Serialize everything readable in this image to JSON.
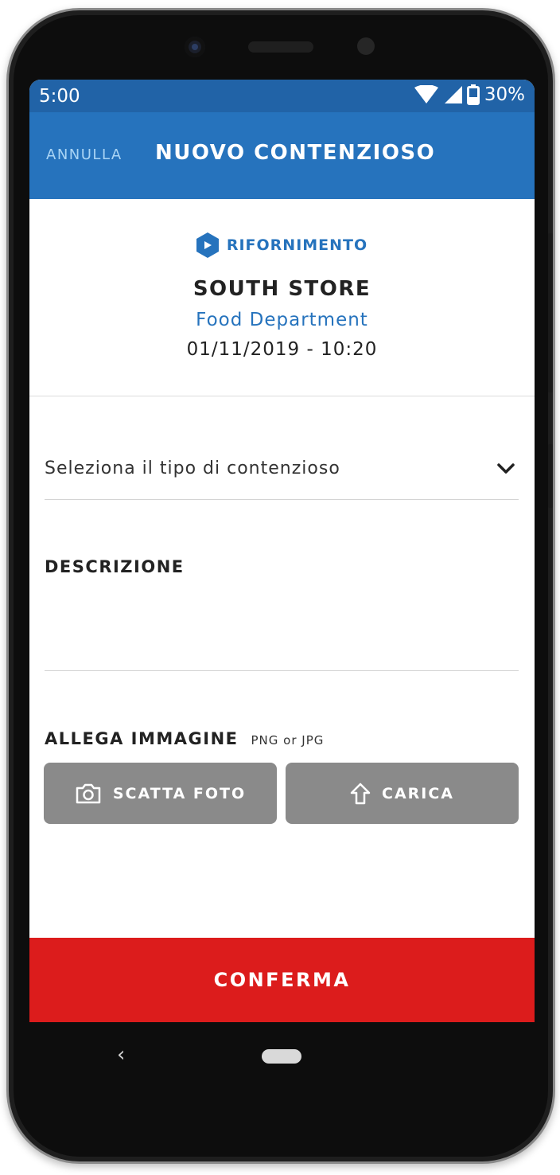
{
  "status_bar": {
    "time": "5:00",
    "battery": "30%"
  },
  "app_bar": {
    "cancel_label": "ANNULLA",
    "title": "NUOVO CONTENZIOSO"
  },
  "header": {
    "category": "RIFORNIMENTO",
    "store": "SOUTH STORE",
    "department": "Food Department",
    "datetime": "01/11/2019 - 10:20"
  },
  "form": {
    "type_select": {
      "placeholder": "Seleziona il tipo di contenzioso"
    },
    "description": {
      "label": "DESCRIZIONE",
      "value": ""
    },
    "attach": {
      "label": "ALLEGA IMMAGINE",
      "hint": "PNG or JPG",
      "take_photo_label": "SCATTA FOTO",
      "upload_label": "CARICA"
    }
  },
  "confirm_label": "CONFERMA",
  "colors": {
    "app_bar": "#2673bd",
    "status_bar": "#2163a7",
    "accent": "#2673bd",
    "confirm": "#dc1c1c",
    "button_grey": "#8a8a8a"
  },
  "icons": [
    "wifi-icon",
    "signal-icon",
    "battery-icon",
    "hexagon-play-icon",
    "chevron-down-icon",
    "camera-icon",
    "upload-arrow-icon",
    "back-icon",
    "home-icon"
  ]
}
